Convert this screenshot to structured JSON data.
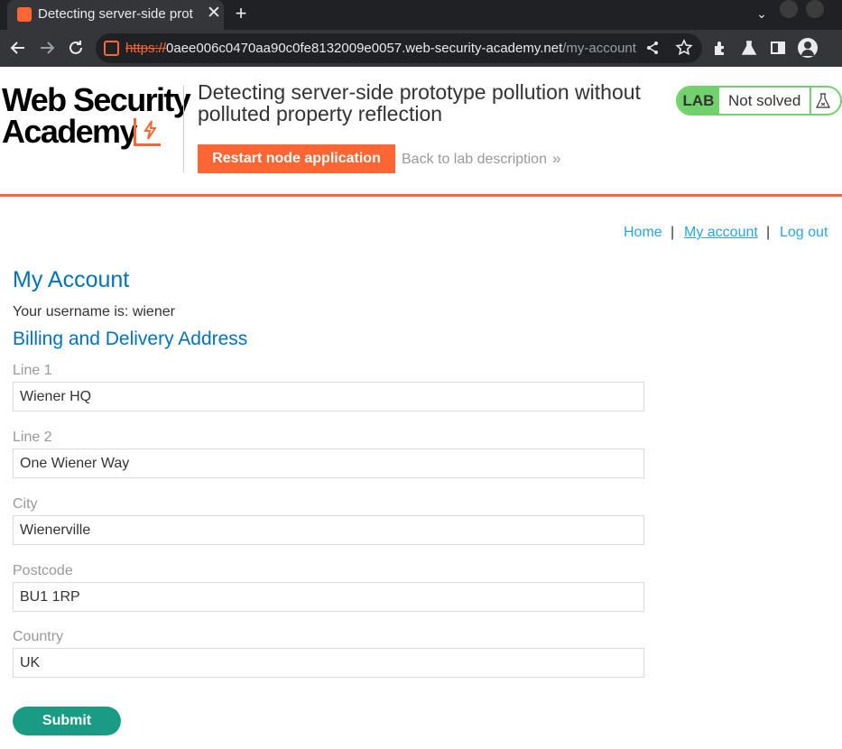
{
  "browser": {
    "tab_title": "Detecting server-side prot",
    "tab_close": "✕",
    "new_tab": "+",
    "tabs_dropdown": "⌄",
    "url_scheme": "https://",
    "url_host": "0aee006c0470aa90c0fe8132009e0057.web-security-academy.net",
    "url_path": "/my-account",
    "icons": [
      "back-arrow-icon",
      "forward-arrow-icon",
      "reload-icon",
      "share-icon",
      "star-icon",
      "extensions-icon",
      "labs-flask-icon",
      "side-panel-icon",
      "profile-avatar-icon"
    ]
  },
  "header": {
    "logo_line1": "Web Security",
    "logo_line2": "Academy",
    "lab_title": "Detecting server-side prototype pollution without polluted property reflection",
    "lab_badge_tag": "LAB",
    "lab_status": "Not solved",
    "restart_label": "Restart node application",
    "back_label": "Back to lab description",
    "back_chevron": "»"
  },
  "nav": {
    "home": "Home",
    "my_account": "My account",
    "log_out": "Log out",
    "separator": "|"
  },
  "account": {
    "title": "My Account",
    "username_text": "Your username is: wiener",
    "address_heading": "Billing and Delivery Address",
    "fields": [
      {
        "label": "Line 1",
        "value": "Wiener HQ"
      },
      {
        "label": "Line 2",
        "value": "One Wiener Way"
      },
      {
        "label": "City",
        "value": "Wienerville"
      },
      {
        "label": "Postcode",
        "value": "BU1 1RP"
      },
      {
        "label": "Country",
        "value": "UK"
      }
    ],
    "submit_label": "Submit"
  },
  "colors": {
    "accent_orange": "#ff6633",
    "link_blue": "#29a5dd",
    "heading_blue": "#0071bc",
    "lab_green": "#70d16d",
    "submit_green": "#1a9c84"
  }
}
